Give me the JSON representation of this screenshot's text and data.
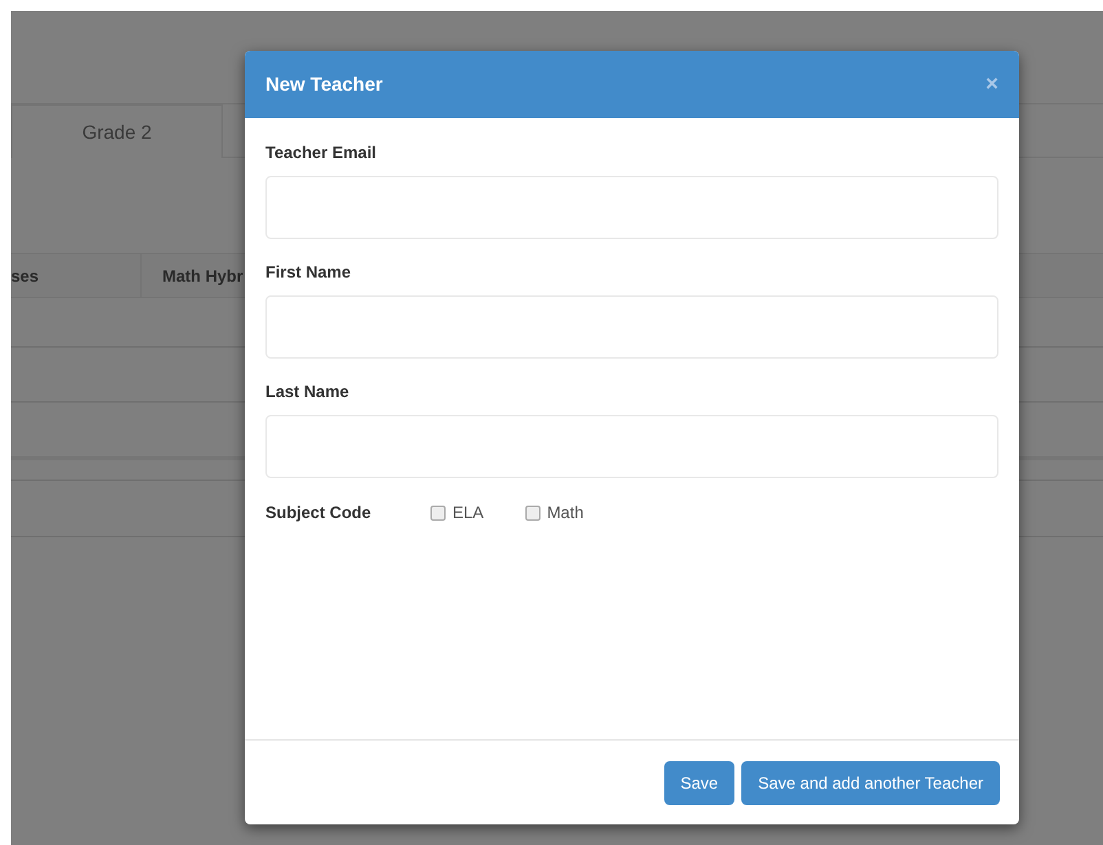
{
  "background": {
    "tabs": [
      {
        "label": "Grade 2",
        "selected": true
      }
    ],
    "table": {
      "columns": [
        "ses",
        "Math Hybr"
      ]
    }
  },
  "dialog": {
    "title": "New Teacher",
    "close": "×",
    "fields": [
      {
        "label": "Teacher Email"
      },
      {
        "label": "First Name"
      },
      {
        "label": "Last Name"
      }
    ],
    "subject_code": {
      "label": "Subject Code",
      "options": [
        {
          "label": "ELA",
          "checked": false
        },
        {
          "label": "Math",
          "checked": false
        }
      ]
    },
    "buttons": [
      "Save",
      "Save and add another Teacher"
    ]
  }
}
